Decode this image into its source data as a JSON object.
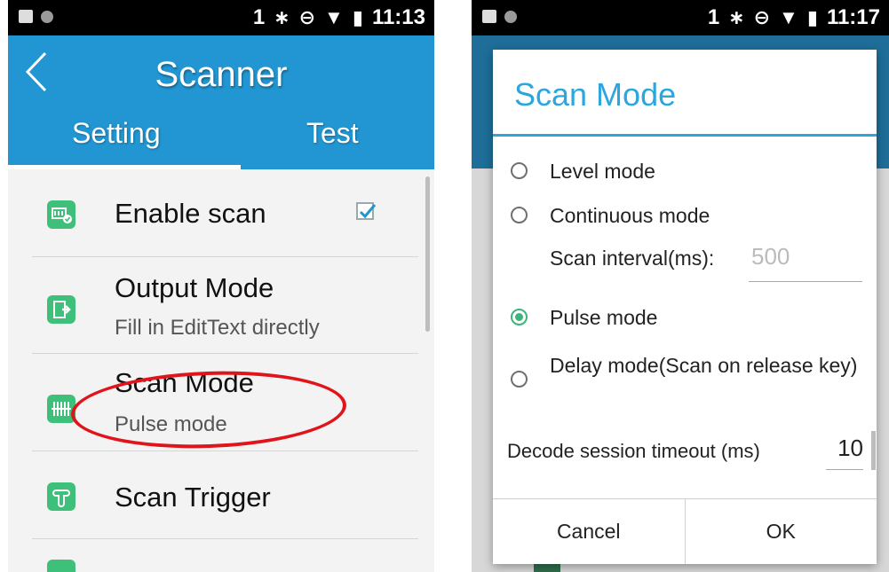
{
  "left": {
    "statusbar": {
      "sim": "1",
      "bt": "∗",
      "dnd": "⊖",
      "wifi": "▼",
      "battery": "▮",
      "time": "11:13"
    },
    "appbar": {
      "title": "Scanner",
      "back_icon": "chevron-left-icon",
      "tabs": [
        {
          "label": "Setting",
          "active": true
        },
        {
          "label": "Test",
          "active": false
        }
      ]
    },
    "list": [
      {
        "title": "Enable scan",
        "subtitle": "",
        "icon": "barcode-check-icon",
        "checked": true
      },
      {
        "title": "Output Mode",
        "subtitle": "Fill in EditText directly",
        "icon": "export-icon"
      },
      {
        "title": "Scan Mode",
        "subtitle": "Pulse mode",
        "icon": "scan-mode-icon"
      },
      {
        "title": "Scan Trigger",
        "subtitle": "",
        "icon": "trigger-icon"
      }
    ],
    "colors": {
      "appbar": "#2196d2",
      "icon": "#3fc07a",
      "highlight": "#e0141b"
    }
  },
  "right": {
    "statusbar": {
      "sim": "1",
      "bt": "∗",
      "dnd": "⊖",
      "wifi": "▼",
      "battery": "▮",
      "time": "11:17"
    },
    "dialog": {
      "title": "Scan Mode",
      "options": [
        {
          "label": "Level mode",
          "selected": false
        },
        {
          "label": "Continuous mode",
          "selected": false
        },
        {
          "label": "Pulse mode",
          "selected": true
        },
        {
          "label": "Delay mode(Scan on release key)",
          "selected": false
        }
      ],
      "interval_label": "Scan interval(ms):",
      "interval_value": "500",
      "timeout_label": "Decode session timeout (ms)",
      "timeout_value": "10",
      "cancel": "Cancel",
      "ok": "OK"
    },
    "colors": {
      "accent": "#2ba6df",
      "radio": "#3fb37a"
    }
  }
}
